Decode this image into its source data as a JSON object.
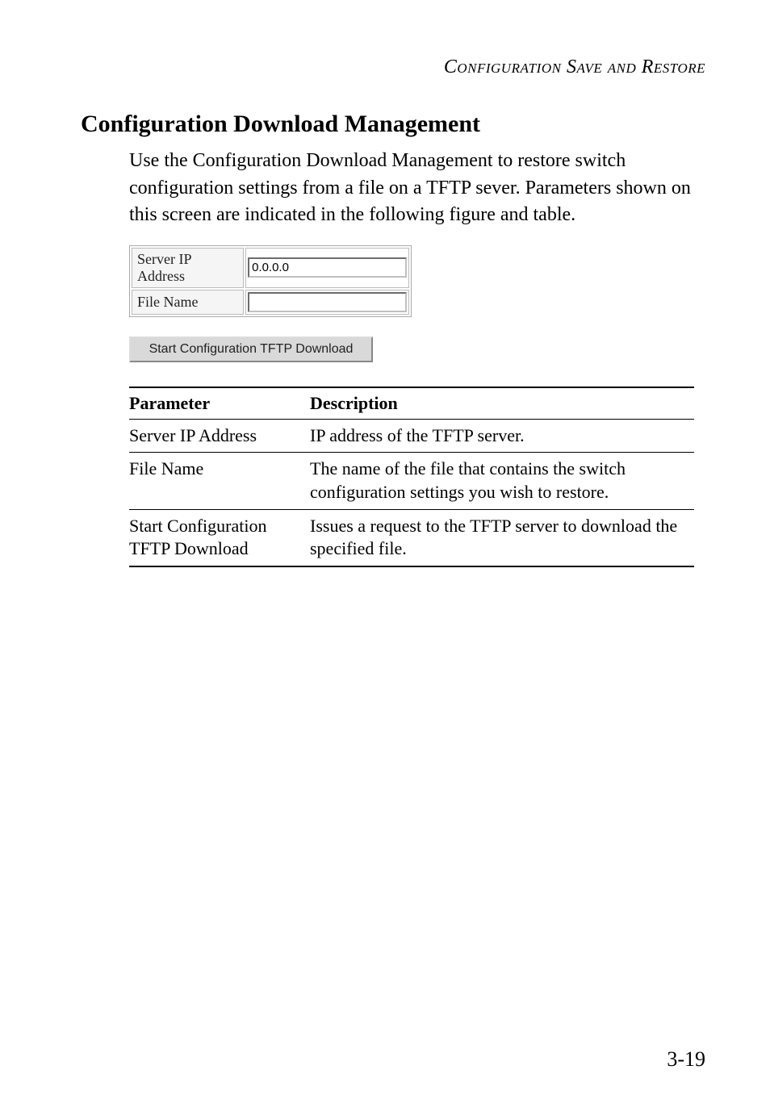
{
  "running_header": "Configuration Save and Restore",
  "heading": "Configuration Download Management",
  "paragraph": "Use the Configuration Download Management to restore switch configuration settings from a file on a TFTP sever. Parameters shown on this screen are indicated in the following figure and table.",
  "form": {
    "server_ip_label": "Server IP Address",
    "server_ip_value": "0.0.0.0",
    "file_name_label": "File Name",
    "file_name_value": ""
  },
  "button_label": "Start Configuration TFTP Download",
  "table": {
    "head_param": "Parameter",
    "head_desc": "Description",
    "rows": [
      {
        "param": "Server IP Address",
        "desc": "IP address of the TFTP server."
      },
      {
        "param": "File Name",
        "desc": "The name of the file that contains the switch configuration settings you wish to restore."
      },
      {
        "param": "Start Configuration TFTP Download",
        "desc": "Issues a request to the TFTP server to download the specified file."
      }
    ]
  },
  "page_number": "3-19"
}
